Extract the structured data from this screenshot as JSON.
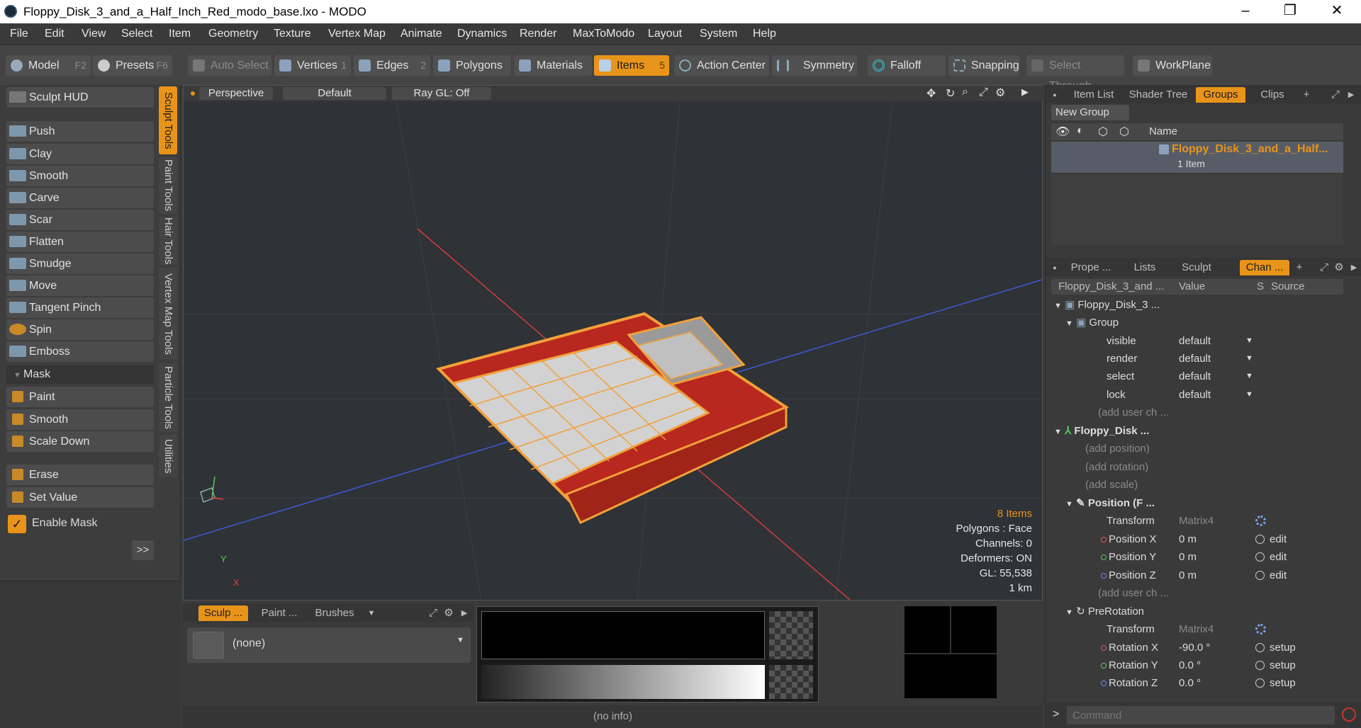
{
  "window": {
    "title": "Floppy_Disk_3_and_a_Half_Inch_Red_modo_base.lxo - MODO",
    "minimize": "–",
    "maximize": "❐",
    "close": "✕"
  },
  "menu": [
    "File",
    "Edit",
    "View",
    "Select",
    "Item",
    "Geometry",
    "Texture",
    "Vertex Map",
    "Animate",
    "Dynamics",
    "Render",
    "MaxToModo",
    "Layout",
    "System",
    "Help"
  ],
  "toolbar": {
    "model": "Model",
    "model_key": "F2",
    "presets": "Presets",
    "presets_key": "F6",
    "auto_select": "Auto Select",
    "vertices": "Vertices",
    "vertices_key": "1",
    "edges": "Edges",
    "edges_key": "2",
    "polygons": "Polygons",
    "materials": "Materials",
    "items": "Items",
    "items_key": "5",
    "action_center": "Action Center",
    "symmetry": "Symmetry",
    "falloff": "Falloff",
    "snapping": "Snapping",
    "select_through": "Select Through",
    "workplane": "WorkPlane"
  },
  "sculpt": {
    "hud": "Sculpt HUD",
    "tools": [
      "Push",
      "Clay",
      "Smooth",
      "Carve",
      "Scar",
      "Flatten",
      "Smudge",
      "Move",
      "Tangent Pinch",
      "Spin",
      "Emboss"
    ],
    "mask_header": "Mask",
    "mask_tools": [
      "Paint",
      "Smooth",
      "Scale Down"
    ],
    "erase": "Erase",
    "set_value": "Set Value",
    "enable_mask": "Enable Mask",
    "more": ">>"
  },
  "vtabs": [
    "Sculpt Tools",
    "Paint Tools",
    "Hair Tools",
    "Vertex Map Tools",
    "Particle Tools",
    "Utilities"
  ],
  "viewport": {
    "view": "Perspective",
    "shading": "Default",
    "raygl": "Ray GL: Off",
    "axis_y": "Y",
    "axis_x": "X",
    "info": {
      "items": "8 Items",
      "polygons": "Polygons : Face",
      "channels": "Channels: 0",
      "deformers": "Deformers: ON",
      "gl": "GL: 55,538",
      "scale": "1 km"
    }
  },
  "bottom": {
    "tabs": [
      "Sculp ...",
      "Paint ...",
      "Brushes"
    ],
    "brush_value": "(none)",
    "status": "(no info)"
  },
  "groups_panel": {
    "tabs": [
      "Item List",
      "Shader Tree",
      "Groups",
      "Clips"
    ],
    "new_group": "New Group",
    "col_name": "Name",
    "group_name": "Floppy_Disk_3_and_a_Half...",
    "group_count": "1 Item"
  },
  "channels_panel": {
    "tabs": [
      "Prope ...",
      "Lists",
      "Sculpt",
      "Chan ..."
    ],
    "col_item": "Floppy_Disk_3_and ...",
    "col_value": "Value",
    "col_s": "S",
    "col_source": "Source",
    "rows": [
      {
        "name": "Floppy_Disk_3 ...",
        "value": "",
        "source": ""
      },
      {
        "name": "Group",
        "value": "",
        "source": ""
      },
      {
        "name": "visible",
        "value": "default",
        "source": ""
      },
      {
        "name": "render",
        "value": "default",
        "source": ""
      },
      {
        "name": "select",
        "value": "default",
        "source": ""
      },
      {
        "name": "lock",
        "value": "default",
        "source": ""
      },
      {
        "name": "(add user ch ...",
        "value": "",
        "source": ""
      },
      {
        "name": "Floppy_Disk ...",
        "value": "",
        "source": ""
      },
      {
        "name": "(add position)",
        "value": "",
        "source": ""
      },
      {
        "name": "(add rotation)",
        "value": "",
        "source": ""
      },
      {
        "name": "(add scale)",
        "value": "",
        "source": ""
      },
      {
        "name": "Position (F ...",
        "value": "",
        "source": ""
      },
      {
        "name": "Transform",
        "value": "Matrix4",
        "source": ""
      },
      {
        "name": "Position X",
        "value": "0 m",
        "source": "edit"
      },
      {
        "name": "Position Y",
        "value": "0 m",
        "source": "edit"
      },
      {
        "name": "Position Z",
        "value": "0 m",
        "source": "edit"
      },
      {
        "name": "(add user ch ...",
        "value": "",
        "source": ""
      },
      {
        "name": "PreRotation",
        "value": "",
        "source": ""
      },
      {
        "name": "Transform",
        "value": "Matrix4",
        "source": ""
      },
      {
        "name": "Rotation X",
        "value": "-90.0 °",
        "source": "setup"
      },
      {
        "name": "Rotation Y",
        "value": "0.0 °",
        "source": "setup"
      },
      {
        "name": "Rotation Z",
        "value": "0.0 °",
        "source": "setup"
      }
    ]
  },
  "command": {
    "prompt": ">",
    "placeholder": "Command"
  },
  "colors": {
    "accent": "#e8941a",
    "mesh_orange": "#f2a03a",
    "mesh_red": "#b8281e",
    "axis_red": "#d23c3c",
    "axis_blue": "#3a5ad8"
  }
}
